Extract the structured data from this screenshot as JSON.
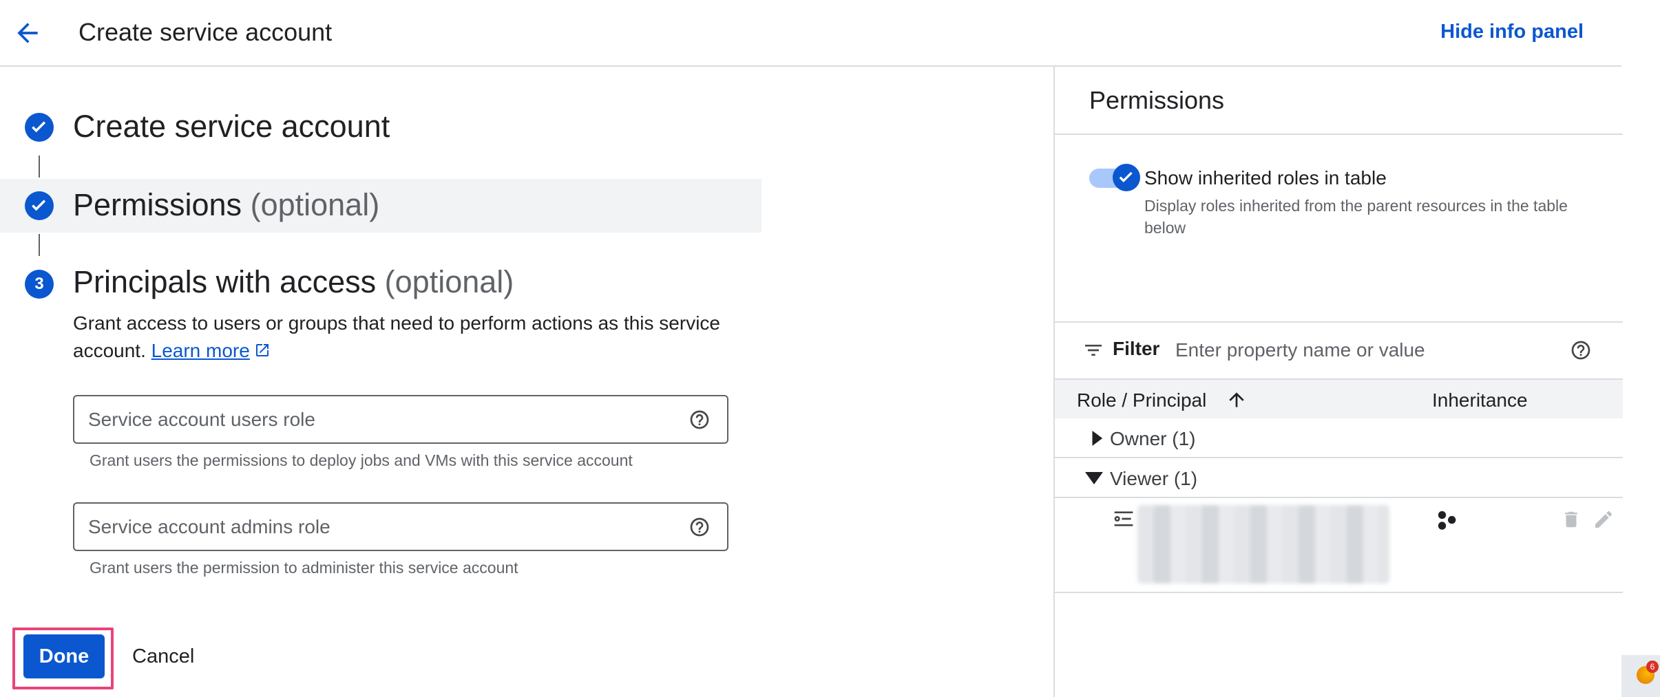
{
  "header": {
    "title": "Create service account",
    "hide_info_panel": "Hide info panel"
  },
  "steps": [
    {
      "title": "Create service account",
      "optional": "",
      "status": "complete"
    },
    {
      "title": "Permissions",
      "optional": "(optional)",
      "status": "complete"
    },
    {
      "number": "3",
      "title": "Principals with access",
      "optional": "(optional)",
      "status": "current"
    }
  ],
  "principals": {
    "description": "Grant access to users or groups that need to perform actions as this service account.",
    "learn_more": "Learn more",
    "users_role": {
      "placeholder": "Service account users role",
      "value": "",
      "hint": "Grant users the permissions to deploy jobs and VMs with this service account"
    },
    "admins_role": {
      "placeholder": "Service account admins role",
      "value": "",
      "hint": "Grant users the permission to administer this service account"
    }
  },
  "actions": {
    "done": "Done",
    "cancel": "Cancel"
  },
  "panel": {
    "title": "Permissions",
    "toggle": {
      "label": "Show inherited roles in table",
      "description": "Display roles inherited from the parent resources in the table below",
      "on": true
    },
    "filter": {
      "label": "Filter",
      "placeholder": "Enter property name or value"
    },
    "table": {
      "col_role": "Role / Principal",
      "col_inheritance": "Inheritance",
      "groups": [
        {
          "label": "Owner (1)",
          "expanded": false
        },
        {
          "label": "Viewer (1)",
          "expanded": true
        }
      ]
    }
  },
  "notification_count": "6",
  "colors": {
    "accent": "#0b57d0",
    "highlight": "#e8447a",
    "muted": "#5f6368"
  }
}
